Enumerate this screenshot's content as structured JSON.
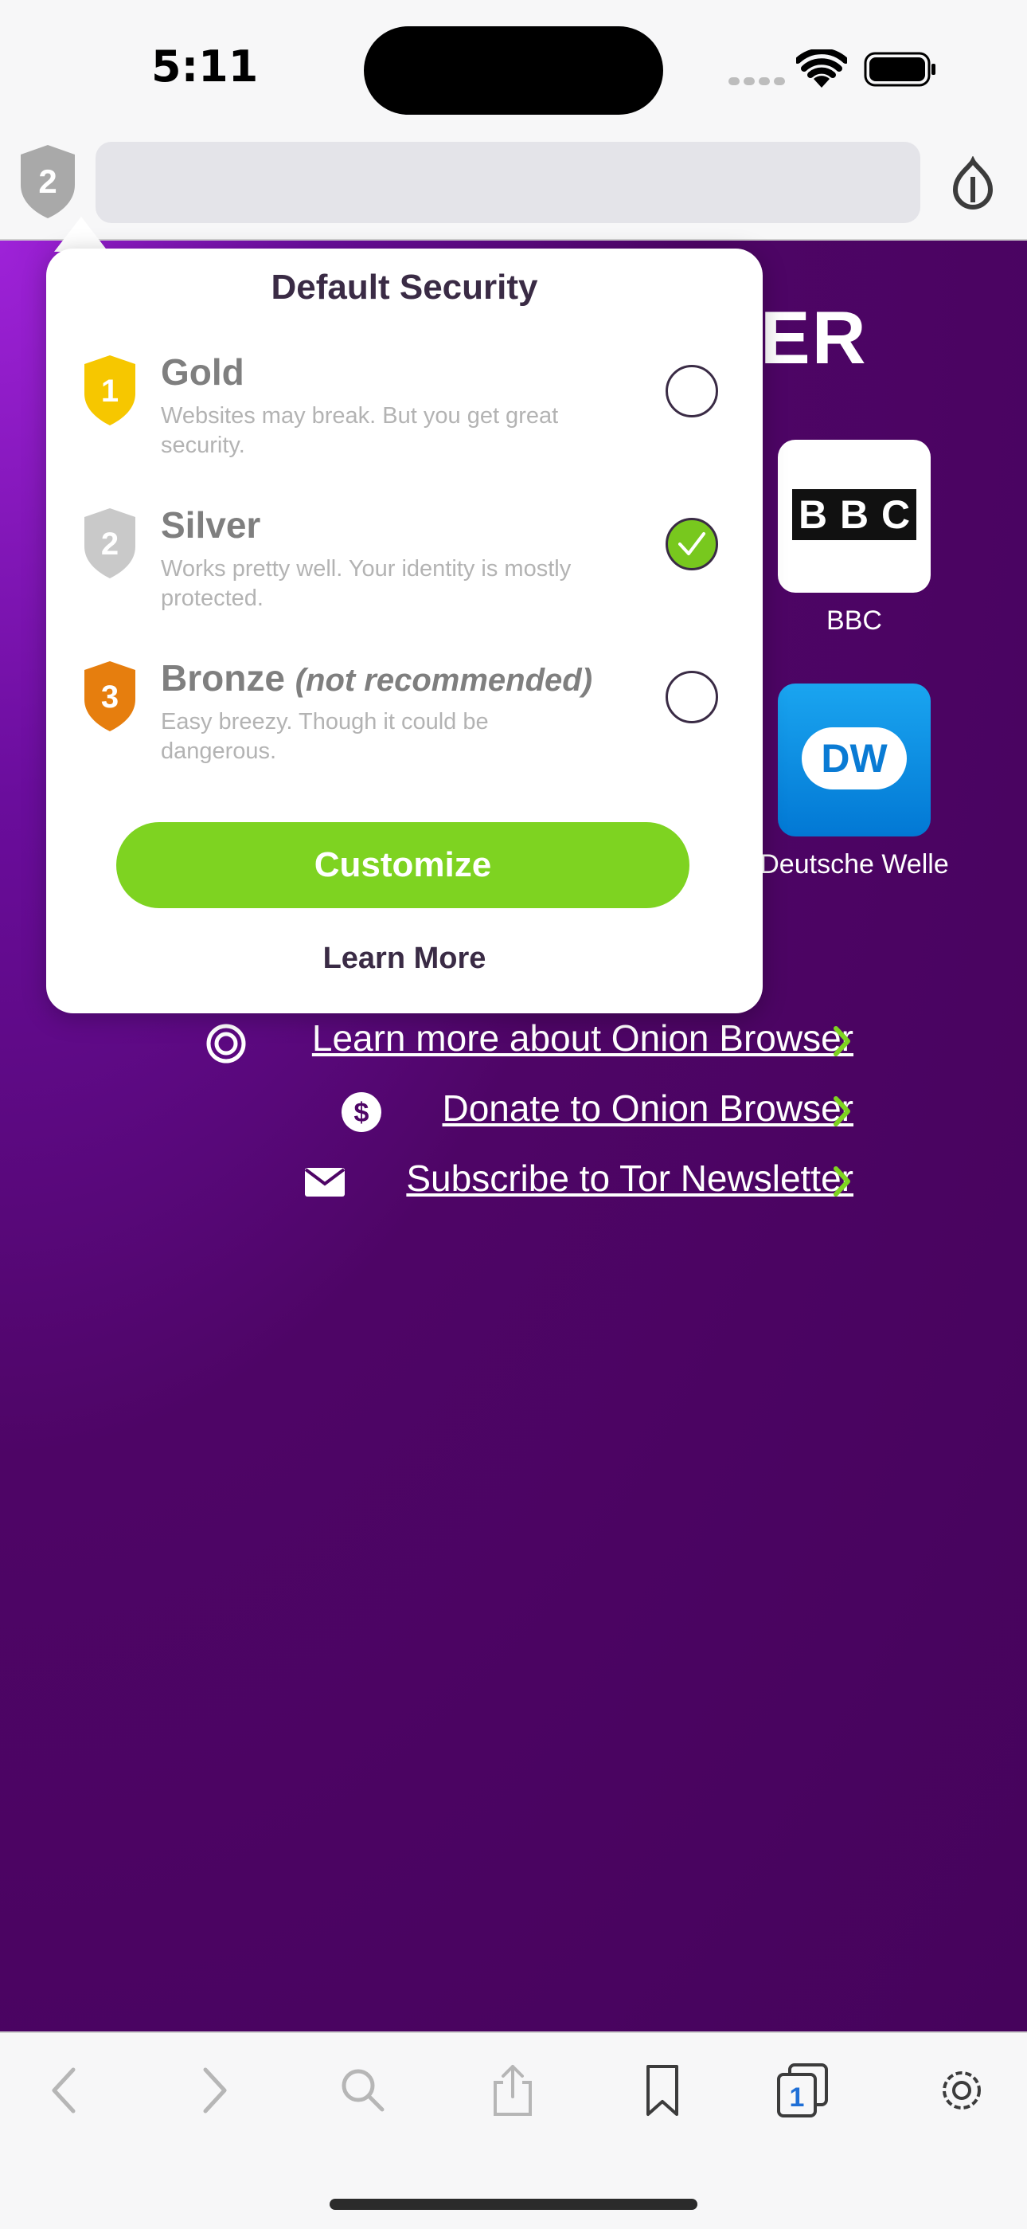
{
  "status_bar": {
    "time": "5:11"
  },
  "toolbar": {
    "security_level_badge": "2",
    "url_value": ""
  },
  "page": {
    "heading_fragment": "ER",
    "bookmarks": [
      {
        "label": "BBC",
        "logo_letters": [
          "B",
          "B",
          "C"
        ]
      },
      {
        "label": "Deutsche Welle",
        "logo_text": "DW"
      }
    ],
    "links": [
      {
        "text": "Learn more about Onion Browser",
        "icon": "onion-icon"
      },
      {
        "text": "Donate to Onion Browser",
        "icon": "dollar-icon"
      },
      {
        "text": "Subscribe to Tor Newsletter",
        "icon": "envelope-icon"
      }
    ]
  },
  "popover": {
    "title": "Default Security",
    "levels": [
      {
        "number": "1",
        "name": "Gold",
        "suffix": "",
        "description": "Websites may break. But you get great security.",
        "selected": false,
        "color": "#f6c700"
      },
      {
        "number": "2",
        "name": "Silver",
        "suffix": "",
        "description": "Works pretty well. Your identity is mostly protected.",
        "selected": true,
        "color": "#c9c9c9"
      },
      {
        "number": "3",
        "name": "Bronze",
        "suffix": "(not recommended)",
        "description": "Easy breezy. Though it could be dangerous.",
        "selected": false,
        "color": "#e67e0e"
      }
    ],
    "customize_label": "Customize",
    "learn_more_label": "Learn More"
  },
  "bottom_toolbar": {
    "tabs_count": "1"
  },
  "colors": {
    "accent_green": "#7ed321",
    "page_purple": "#4e0566",
    "ink": "#3a2b45"
  }
}
